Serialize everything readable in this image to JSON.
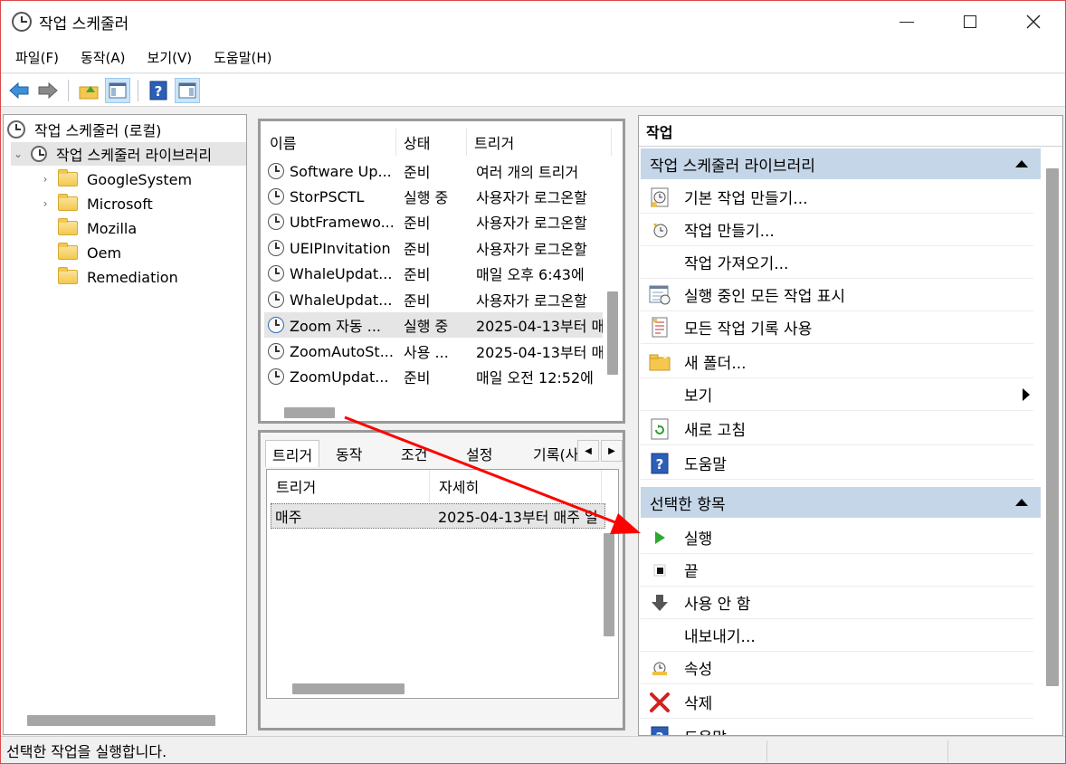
{
  "window": {
    "title": "작업 스케줄러"
  },
  "menu": [
    "파일(F)",
    "동작(A)",
    "보기(V)",
    "도움말(H)"
  ],
  "tree": {
    "root": "작업 스케줄러 (로컬)",
    "library": "작업 스케줄러 라이브러리",
    "folders": [
      "GoogleSystem",
      "Microsoft",
      "Mozilla",
      "Oem",
      "Remediation"
    ]
  },
  "task_list": {
    "columns": [
      "이름",
      "상태",
      "트리거"
    ],
    "rows": [
      {
        "name": "Software Up...",
        "status": "준비",
        "trigger": "여러 개의 트리거"
      },
      {
        "name": "StorPSCTL",
        "status": "실행 중",
        "trigger": "사용자가 로그온할"
      },
      {
        "name": "UbtFramewo...",
        "status": "준비",
        "trigger": "사용자가 로그온할"
      },
      {
        "name": "UEIPInvitation",
        "status": "준비",
        "trigger": "사용자가 로그온할"
      },
      {
        "name": "WhaleUpdat...",
        "status": "준비",
        "trigger": "매일 오후 6:43에"
      },
      {
        "name": "WhaleUpdat...",
        "status": "준비",
        "trigger": "사용자가 로그온할"
      },
      {
        "name": "Zoom 자동 ...",
        "status": "실행 중",
        "trigger": "2025-04-13부터 매"
      },
      {
        "name": "ZoomAutoSt...",
        "status": "사용 ...",
        "trigger": "2025-04-13부터 매"
      },
      {
        "name": "ZoomUpdat...",
        "status": "준비",
        "trigger": "매일 오전 12:52에"
      }
    ]
  },
  "detail_tabs": [
    "트리거",
    "동작",
    "조건",
    "설정",
    "기록(사"
  ],
  "triggers": {
    "columns": [
      "트리거",
      "자세히"
    ],
    "rows": [
      {
        "trigger": "매주",
        "detail": "2025-04-13부터 매주 일"
      }
    ]
  },
  "actions": {
    "title": "작업",
    "section1": {
      "title": "작업 스케줄러 라이브러리",
      "items": [
        "기본 작업 만들기...",
        "작업 만들기...",
        "작업 가져오기...",
        "실행 중인 모든 작업 표시",
        "모든 작업 기록 사용",
        "새 폴더...",
        "보기",
        "새로 고침",
        "도움말"
      ]
    },
    "section2": {
      "title": "선택한 항목",
      "items": [
        "실행",
        "끝",
        "사용 안 함",
        "내보내기...",
        "속성",
        "삭제",
        "도움말"
      ]
    }
  },
  "status": "선택한 작업을 실행합니다.",
  "colors": {
    "accent_section": "#c6d6e9",
    "annotation_arrow": "#ff0000",
    "selection": "#e5e5e5"
  }
}
